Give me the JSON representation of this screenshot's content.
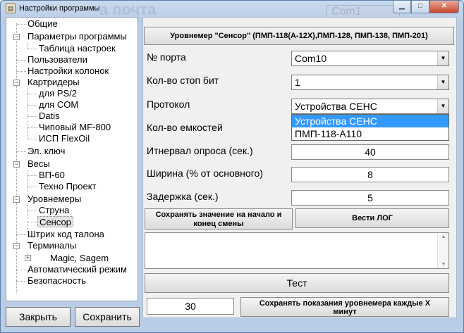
{
  "window": {
    "title": "Настройки программы",
    "bg_text_left": "а почта",
    "bg_text_right": "Com1"
  },
  "tree": {
    "items": [
      {
        "label": "Общие"
      },
      {
        "label": "Параметры программы"
      },
      {
        "label": "Таблица настроек"
      },
      {
        "label": "Пользователи"
      },
      {
        "label": "Настройки колонок"
      },
      {
        "label": "Картридеры"
      },
      {
        "label": "для PS/2"
      },
      {
        "label": "для COM"
      },
      {
        "label": "Datis"
      },
      {
        "label": "Чиповый MF-800"
      },
      {
        "label": "ИСП FlexOil"
      },
      {
        "label": "Эл. ключ"
      },
      {
        "label": "Весы"
      },
      {
        "label": "ВП-60"
      },
      {
        "label": "Техно Проект"
      },
      {
        "label": "Уровнемеры"
      },
      {
        "label": "Струна"
      },
      {
        "label": "Сенсор"
      },
      {
        "label": "Штрих код талона"
      },
      {
        "label": "Терминалы"
      },
      {
        "label": "Magic, Sagem"
      },
      {
        "label": "Автоматический режим"
      },
      {
        "label": "Безопасность"
      }
    ]
  },
  "buttons": {
    "close": "Закрыть",
    "save": "Сохранить"
  },
  "device": {
    "header": "Уровнемер \"Сенсор\" (ПМП-118(А-12Х),ПМП-128, ПМП-138, ПМП-201)",
    "port_label": "№ порта",
    "port_value": "Com10",
    "stopbits_label": "Кол-во стоп бит",
    "stopbits_value": "1",
    "protocol_label": "Протокол",
    "protocol_value": "Устройства СЕНС",
    "protocol_options": [
      "Устройства СЕНС",
      "ПМП-118-А110"
    ],
    "tanks_label": "Кол-во емкостей",
    "interval_label": "Итнервал опроса (сек.)",
    "interval_value": "40",
    "width_label": "Ширина  (% от основного)",
    "width_value": "8",
    "delay_label": "Задержка (сек.)",
    "delay_value": "5",
    "save_shift_line1": "Сохранять значение на начало и",
    "save_shift_line2": "конец смены",
    "log_button": "Вести ЛОГ",
    "test_button": "Тест",
    "period_value": "30",
    "save_period_line1": "Сохранять показания уровнемера каждые Х",
    "save_period_line2": "минут"
  }
}
